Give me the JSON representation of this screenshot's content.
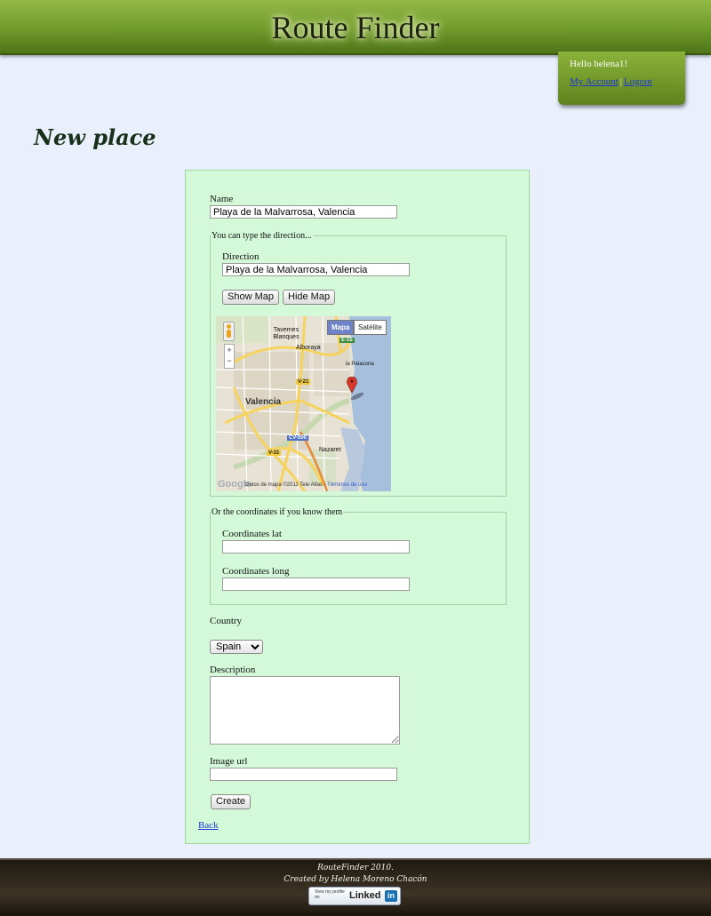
{
  "header": {
    "title": "Route Finder",
    "greeting": "Hello helena1!",
    "my_account_label": "My Account",
    "separator": "|",
    "logout_label": "Logout"
  },
  "page": {
    "heading": "New place"
  },
  "form": {
    "name_label": "Name",
    "name_value": "Playa de la Malvarrosa, Valencia",
    "direction_group_legend": "You can type the direction...",
    "direction_label": "Direction",
    "direction_value": "Playa de la Malvarrosa, Valencia",
    "show_map_label": "Show Map",
    "hide_map_label": "Hide Map",
    "coords_group_legend": "Or the coordinates if you know them",
    "lat_label": "Coordinates lat",
    "lat_value": "",
    "long_label": "Coordinates long",
    "long_value": "",
    "country_label": "Country",
    "country_selected": "Spain",
    "description_label": "Description",
    "description_value": "",
    "image_url_label": "Image url",
    "image_url_value": "",
    "create_label": "Create",
    "back_label": "Back"
  },
  "map": {
    "type_map_label": "Mapa",
    "type_satellite_label": "Satélite",
    "zoom_in": "+",
    "zoom_out": "−",
    "places": [
      "Tavernes Blanques",
      "Alboraya",
      "la Patacona",
      "Valencia",
      "Nazaret"
    ],
    "roads": [
      "E-15",
      "V-21",
      "CV-500",
      "V-31"
    ],
    "attribution": "Datos de mapa ©2011 Tele Atlas -",
    "terms_label": "Términos de uso",
    "logo": "Google",
    "colors": {
      "water": "#a5bfdd",
      "land": "#e8e2d4",
      "road": "#f5d35c",
      "marker": "#d93b2b"
    }
  },
  "footer": {
    "line1": "RouteFinder 2010.",
    "line2": "Created by Helena Moreno Chacón",
    "badge_small": "View my profile on",
    "badge_brand": "Linked",
    "badge_in": "in"
  }
}
